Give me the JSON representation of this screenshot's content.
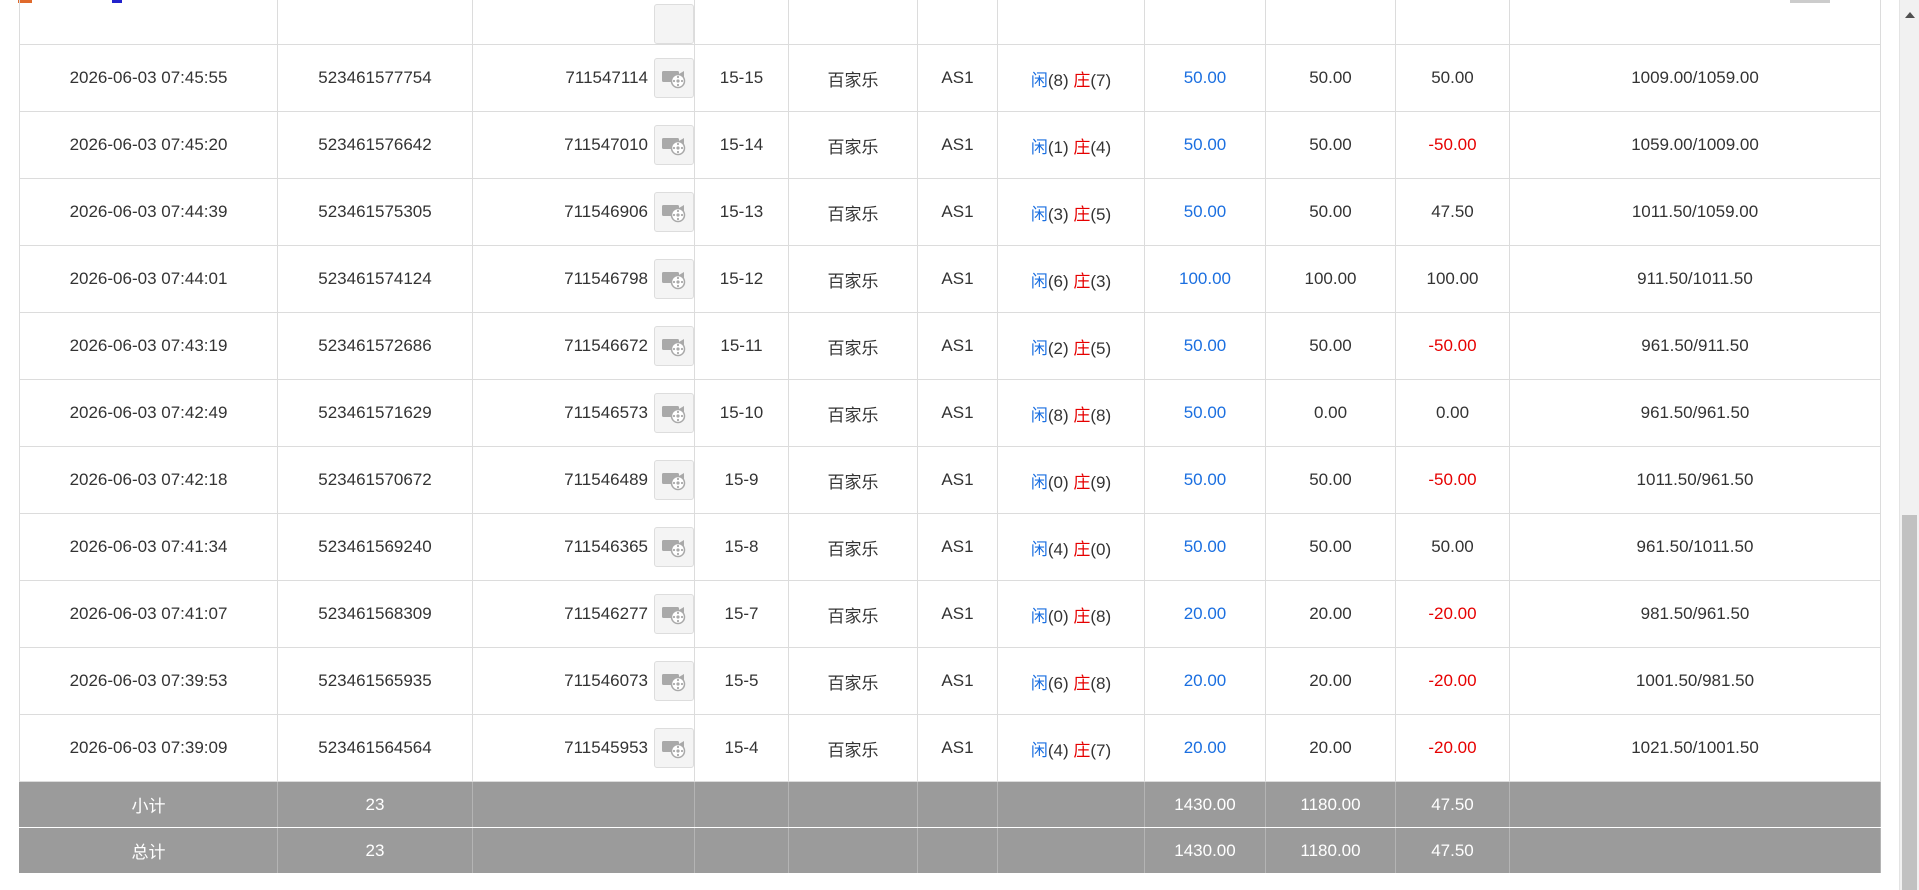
{
  "table": {
    "rows": [
      {
        "time": "2026-06-03 07:45:55",
        "bet_id": "523461577754",
        "round_id": "711547114",
        "shoe": "15-15",
        "game": "百家乐",
        "table": "AS1",
        "player": "闲",
        "player_pts": "(8)",
        "banker": "庄",
        "banker_pts": "(7)",
        "bet": "50.00",
        "valid": "50.00",
        "winloss": "50.00",
        "winloss_negative": false,
        "balance": "1009.00/1059.00"
      },
      {
        "time": "2026-06-03 07:45:20",
        "bet_id": "523461576642",
        "round_id": "711547010",
        "shoe": "15-14",
        "game": "百家乐",
        "table": "AS1",
        "player": "闲",
        "player_pts": "(1)",
        "banker": "庄",
        "banker_pts": "(4)",
        "bet": "50.00",
        "valid": "50.00",
        "winloss": "-50.00",
        "winloss_negative": true,
        "balance": "1059.00/1009.00"
      },
      {
        "time": "2026-06-03 07:44:39",
        "bet_id": "523461575305",
        "round_id": "711546906",
        "shoe": "15-13",
        "game": "百家乐",
        "table": "AS1",
        "player": "闲",
        "player_pts": "(3)",
        "banker": "庄",
        "banker_pts": "(5)",
        "bet": "50.00",
        "valid": "50.00",
        "winloss": "47.50",
        "winloss_negative": false,
        "balance": "1011.50/1059.00"
      },
      {
        "time": "2026-06-03 07:44:01",
        "bet_id": "523461574124",
        "round_id": "711546798",
        "shoe": "15-12",
        "game": "百家乐",
        "table": "AS1",
        "player": "闲",
        "player_pts": "(6)",
        "banker": "庄",
        "banker_pts": "(3)",
        "bet": "100.00",
        "valid": "100.00",
        "winloss": "100.00",
        "winloss_negative": false,
        "balance": "911.50/1011.50"
      },
      {
        "time": "2026-06-03 07:43:19",
        "bet_id": "523461572686",
        "round_id": "711546672",
        "shoe": "15-11",
        "game": "百家乐",
        "table": "AS1",
        "player": "闲",
        "player_pts": "(2)",
        "banker": "庄",
        "banker_pts": "(5)",
        "bet": "50.00",
        "valid": "50.00",
        "winloss": "-50.00",
        "winloss_negative": true,
        "balance": "961.50/911.50"
      },
      {
        "time": "2026-06-03 07:42:49",
        "bet_id": "523461571629",
        "round_id": "711546573",
        "shoe": "15-10",
        "game": "百家乐",
        "table": "AS1",
        "player": "闲",
        "player_pts": "(8)",
        "banker": "庄",
        "banker_pts": "(8)",
        "bet": "50.00",
        "valid": "0.00",
        "winloss": "0.00",
        "winloss_negative": false,
        "balance": "961.50/961.50"
      },
      {
        "time": "2026-06-03 07:42:18",
        "bet_id": "523461570672",
        "round_id": "711546489",
        "shoe": "15-9",
        "game": "百家乐",
        "table": "AS1",
        "player": "闲",
        "player_pts": "(0)",
        "banker": "庄",
        "banker_pts": "(9)",
        "bet": "50.00",
        "valid": "50.00",
        "winloss": "-50.00",
        "winloss_negative": true,
        "balance": "1011.50/961.50"
      },
      {
        "time": "2026-06-03 07:41:34",
        "bet_id": "523461569240",
        "round_id": "711546365",
        "shoe": "15-8",
        "game": "百家乐",
        "table": "AS1",
        "player": "闲",
        "player_pts": "(4)",
        "banker": "庄",
        "banker_pts": "(0)",
        "bet": "50.00",
        "valid": "50.00",
        "winloss": "50.00",
        "winloss_negative": false,
        "balance": "961.50/1011.50"
      },
      {
        "time": "2026-06-03 07:41:07",
        "bet_id": "523461568309",
        "round_id": "711546277",
        "shoe": "15-7",
        "game": "百家乐",
        "table": "AS1",
        "player": "闲",
        "player_pts": "(0)",
        "banker": "庄",
        "banker_pts": "(8)",
        "bet": "20.00",
        "valid": "20.00",
        "winloss": "-20.00",
        "winloss_negative": true,
        "balance": "981.50/961.50"
      },
      {
        "time": "2026-06-03 07:39:53",
        "bet_id": "523461565935",
        "round_id": "711546073",
        "shoe": "15-5",
        "game": "百家乐",
        "table": "AS1",
        "player": "闲",
        "player_pts": "(6)",
        "banker": "庄",
        "banker_pts": "(8)",
        "bet": "20.00",
        "valid": "20.00",
        "winloss": "-20.00",
        "winloss_negative": true,
        "balance": "1001.50/981.50"
      },
      {
        "time": "2026-06-03 07:39:09",
        "bet_id": "523461564564",
        "round_id": "711545953",
        "shoe": "15-4",
        "game": "百家乐",
        "table": "AS1",
        "player": "闲",
        "player_pts": "(4)",
        "banker": "庄",
        "banker_pts": "(7)",
        "bet": "20.00",
        "valid": "20.00",
        "winloss": "-20.00",
        "winloss_negative": true,
        "balance": "1021.50/1001.50"
      }
    ],
    "subtotal": {
      "label": "小计",
      "count": "23",
      "bet": "1430.00",
      "valid": "1180.00",
      "winloss": "47.50"
    },
    "total": {
      "label": "总计",
      "count": "23",
      "bet": "1430.00",
      "valid": "1180.00",
      "winloss": "47.50"
    }
  },
  "icons": {
    "replay": "video-replay-icon"
  },
  "colors": {
    "player": "#1b6fe0",
    "banker": "#e60000",
    "bet_amount": "#1b6fe0",
    "loss": "#e60000",
    "summary_bg": "#9b9b9b"
  }
}
